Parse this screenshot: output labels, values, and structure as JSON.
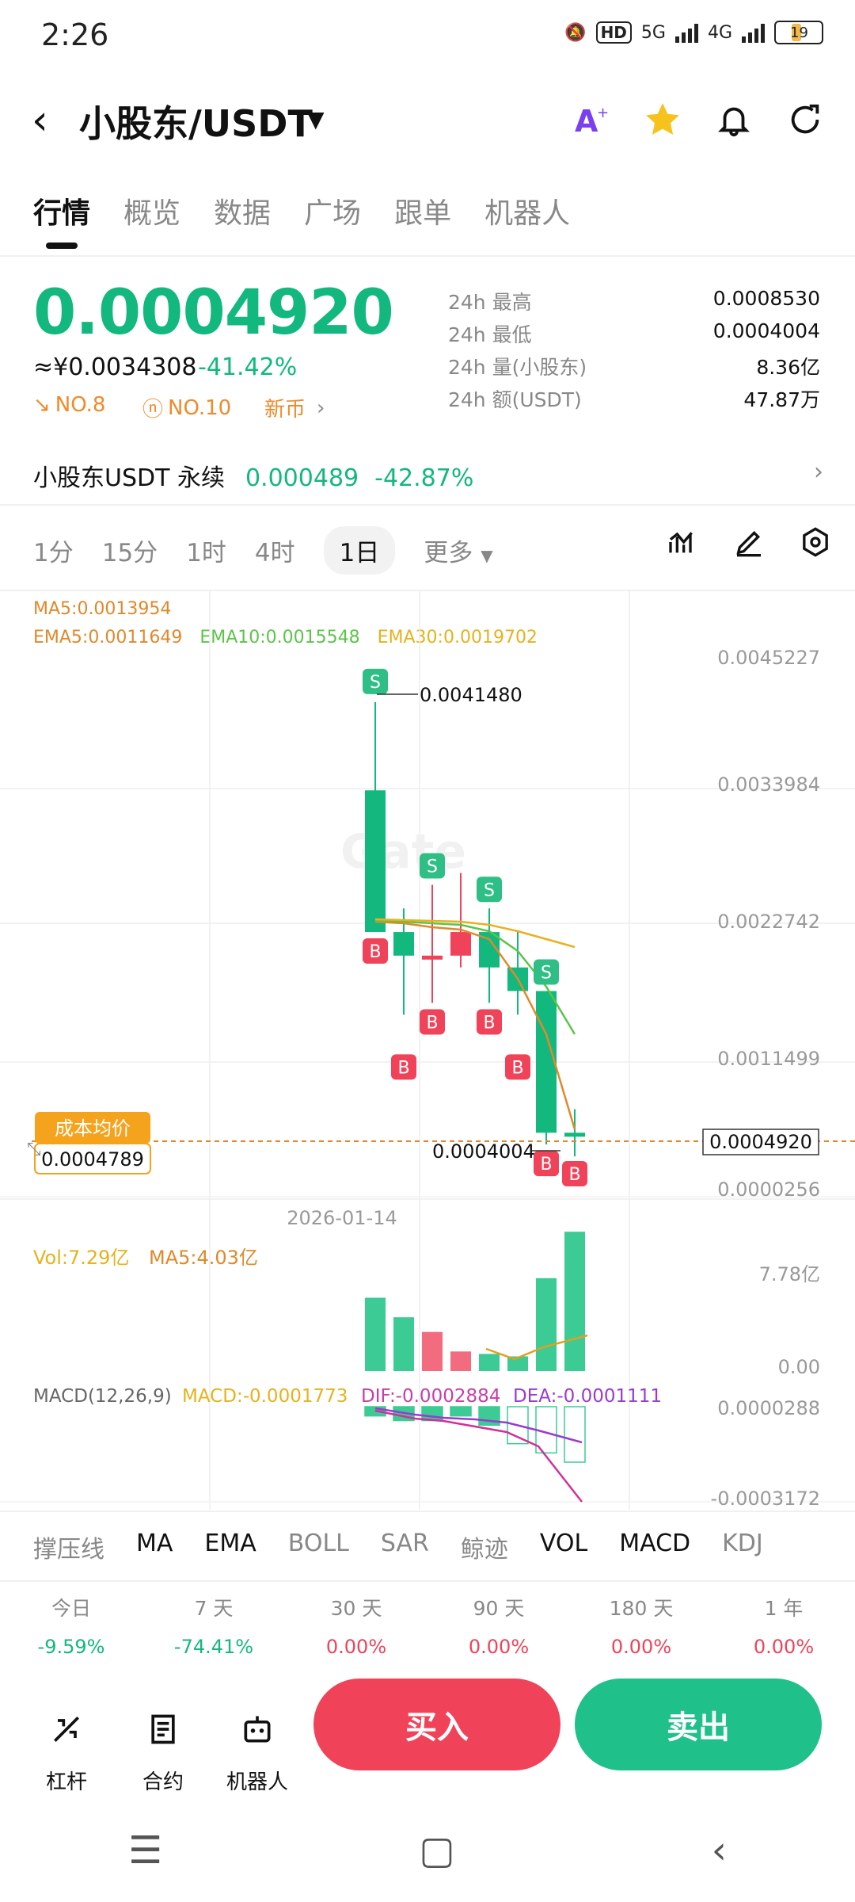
{
  "status": {
    "time": "2:26",
    "network1": "5G",
    "network2": "4G",
    "hd": "HD",
    "battery": "19"
  },
  "header": {
    "pair": "小股东/USDT",
    "icons": [
      "translate-icon",
      "star-icon",
      "bell-icon",
      "share-icon"
    ],
    "star_color": "#f7c21b"
  },
  "tabs": [
    "行情",
    "概览",
    "数据",
    "广场",
    "跟单",
    "机器人"
  ],
  "ticker": {
    "price": "0.0004920",
    "cny": "≈¥0.0034308",
    "change": "-41.42%",
    "rank1": "NO.8",
    "rank2": "NO.10",
    "tag": "新币",
    "stats": [
      {
        "k": "24h  最高",
        "v": "0.0008530"
      },
      {
        "k": "24h  最低",
        "v": "0.0004004"
      },
      {
        "k": "24h  量(小股东)",
        "v": "8.36亿"
      },
      {
        "k": "24h  额(USDT)",
        "v": "47.87万"
      }
    ]
  },
  "perp": {
    "name": "小股东USDT 永续",
    "price": "0.000489",
    "change": "-42.87%"
  },
  "timeframes": {
    "items": [
      "1分",
      "15分",
      "1时",
      "4时",
      "1日",
      "更多"
    ],
    "selected": "1日"
  },
  "chart": {
    "ma5": "MA5:0.0013954",
    "ema5": "EMA5:0.0011649",
    "ema10": "EMA10:0.0015548",
    "ema30": "EMA30:0.0019702",
    "yticks": [
      "0.0045227",
      "0.0033984",
      "0.0022742",
      "0.0011499",
      "0.0000256"
    ],
    "high_label": "0.0041480",
    "low_label": "0.0004004",
    "current": "0.0004920",
    "cost_label": "成本均价",
    "cost_value": "0.0004789",
    "date": "2026-01-14",
    "watermark": "Gate"
  },
  "volume": {
    "vol": "Vol:7.29亿",
    "ma5": "MA5:4.03亿",
    "yticks": [
      "7.78亿",
      "0.00"
    ]
  },
  "macd": {
    "title": "MACD(12,26,9)",
    "macd": "MACD:-0.0001773",
    "dif": "DIF:-0.0002884",
    "dea": "DEA:-0.0001111",
    "yticks": [
      "0.0000288",
      "-0.0003172"
    ]
  },
  "indicators": [
    "撑压线",
    "MA",
    "EMA",
    "BOLL",
    "SAR",
    "鲸迹",
    "VOL",
    "MACD",
    "KDJ"
  ],
  "performance": [
    {
      "label": "今日",
      "value": "-9.59%"
    },
    {
      "label": "7 天",
      "value": "-74.41%"
    },
    {
      "label": "30 天",
      "value": "0.00%"
    },
    {
      "label": "90 天",
      "value": "0.00%"
    },
    {
      "label": "180 天",
      "value": "0.00%"
    },
    {
      "label": "1 年",
      "value": "0.00%"
    }
  ],
  "bottom": {
    "lever": "杠杆",
    "contract": "合约",
    "bot": "机器人",
    "buy": "买入",
    "sell": "卖出"
  },
  "colors": {
    "up": "#13b87e",
    "down": "#f0435a",
    "ema5": "#e0892b",
    "ema10": "#5cc44a",
    "ema30": "#e6b21e"
  },
  "candles": [
    {
      "o": 0.0034,
      "h": 0.004148,
      "l": 0.0022,
      "c": 0.0022,
      "sig": "S-top",
      "b": true
    },
    {
      "o": 0.0022,
      "h": 0.0024,
      "l": 0.0015,
      "c": 0.002,
      "sig": "",
      "b": true
    },
    {
      "o": 0.002,
      "h": 0.0026,
      "l": 0.0016,
      "c": 0.002,
      "sig": "S",
      "b": true
    },
    {
      "o": 0.002,
      "h": 0.0027,
      "l": 0.0019,
      "c": 0.0022,
      "sig": "",
      "b": false
    },
    {
      "o": 0.0022,
      "h": 0.0024,
      "l": 0.0016,
      "c": 0.0019,
      "sig": "S",
      "b": true
    },
    {
      "o": 0.0019,
      "h": 0.0022,
      "l": 0.0015,
      "c": 0.0017,
      "sig": "",
      "b": true
    },
    {
      "o": 0.0017,
      "h": 0.0017,
      "l": 0.0004004,
      "c": 0.0005,
      "sig": "S",
      "b": true
    },
    {
      "o": 0.0005,
      "h": 0.0007,
      "l": 0.0003,
      "c": 0.000492,
      "sig": "",
      "b": true
    }
  ],
  "volumes": [
    0.3,
    0.22,
    0.16,
    0.08,
    0.07,
    0.06,
    0.38,
    0.57
  ],
  "macd_bars": [
    -2e-05,
    -3e-05,
    -3e-05,
    -2e-05,
    -4e-05,
    -8e-05,
    -0.0001,
    -0.00012
  ]
}
